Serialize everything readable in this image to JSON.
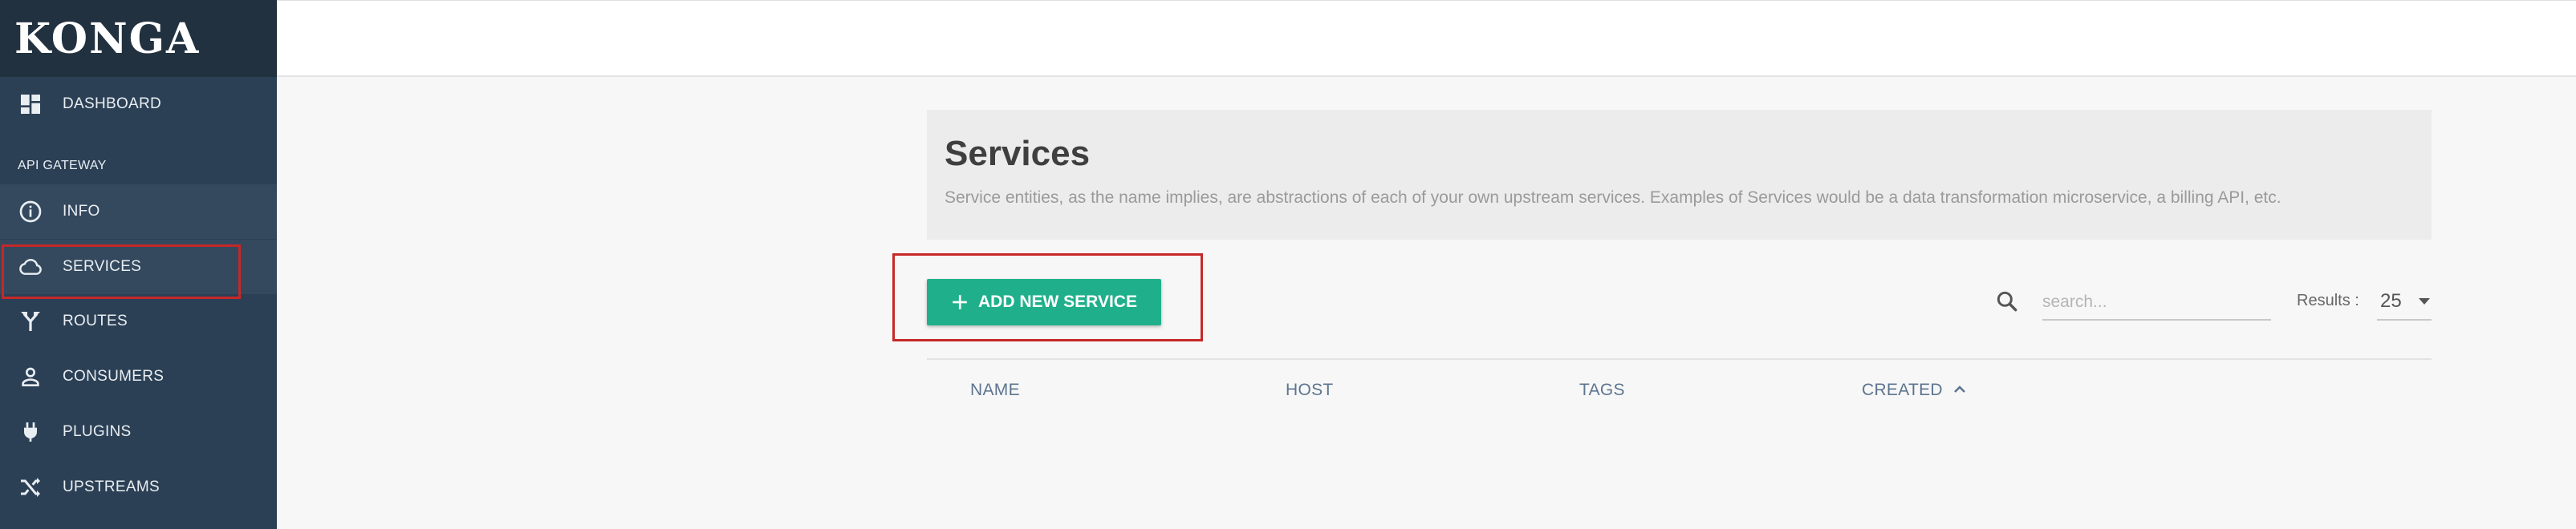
{
  "app": {
    "logo_text": "KONGA"
  },
  "sidebar": {
    "dashboard_label": "DASHBOARD",
    "section_label": "API GATEWAY",
    "items": [
      {
        "label": "INFO",
        "icon": "info-icon"
      },
      {
        "label": "SERVICES",
        "icon": "cloud-icon"
      },
      {
        "label": "ROUTES",
        "icon": "routes-icon"
      },
      {
        "label": "CONSUMERS",
        "icon": "person-icon"
      },
      {
        "label": "PLUGINS",
        "icon": "plug-icon"
      },
      {
        "label": "UPSTREAMS",
        "icon": "shuffle-icon"
      }
    ]
  },
  "main": {
    "title": "Services",
    "description": "Service entities, as the name implies, are abstractions of each of your own upstream services. Examples of Services would be a data transformation microservice, a billing API, etc.",
    "add_button_label": "ADD NEW SERVICE",
    "search": {
      "placeholder": "search...",
      "value": ""
    },
    "results": {
      "label": "Results :",
      "value": "25"
    },
    "table": {
      "columns": [
        "NAME",
        "HOST",
        "TAGS",
        "CREATED"
      ],
      "sort_column": "CREATED",
      "sort_direction": "ascending"
    }
  },
  "colors": {
    "sidebar_bg": "#2c4055",
    "accent": "#1fb08b",
    "highlight": "#c62828"
  }
}
